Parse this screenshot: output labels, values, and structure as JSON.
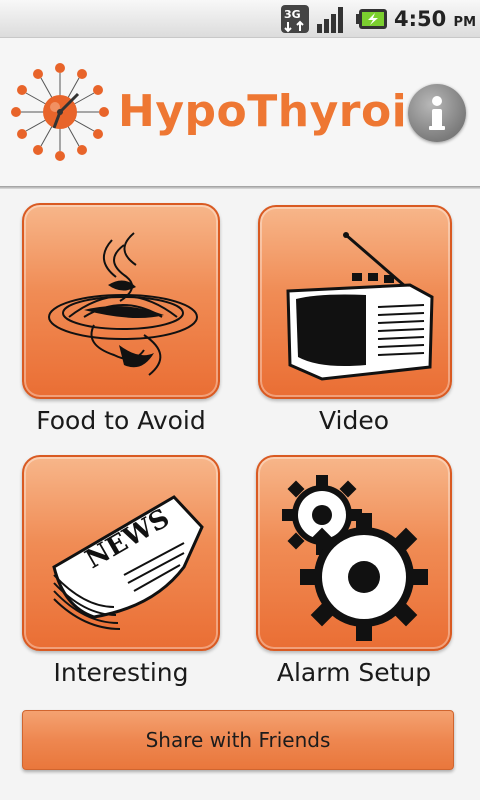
{
  "status_bar": {
    "network": "3G",
    "time": "4:50",
    "ampm": "PM",
    "icons": [
      "3g-data-icon",
      "signal-icon",
      "battery-charging-icon"
    ]
  },
  "header": {
    "title": "HypoThyroid",
    "info_icon": "info-icon",
    "logo_icon": "clock-logo-icon"
  },
  "menu": {
    "items": [
      {
        "label": "Food to Avoid",
        "icon": "food-dish-icon"
      },
      {
        "label": "Video",
        "icon": "tv-icon"
      },
      {
        "label": "Interesting",
        "icon": "newspaper-icon"
      },
      {
        "label": "Alarm Setup",
        "icon": "gears-icon"
      }
    ]
  },
  "share": {
    "label": "Share with Friends"
  },
  "colors": {
    "accent": "#ee7733",
    "tile": "#f08c55",
    "background": "#f4f4f4"
  }
}
